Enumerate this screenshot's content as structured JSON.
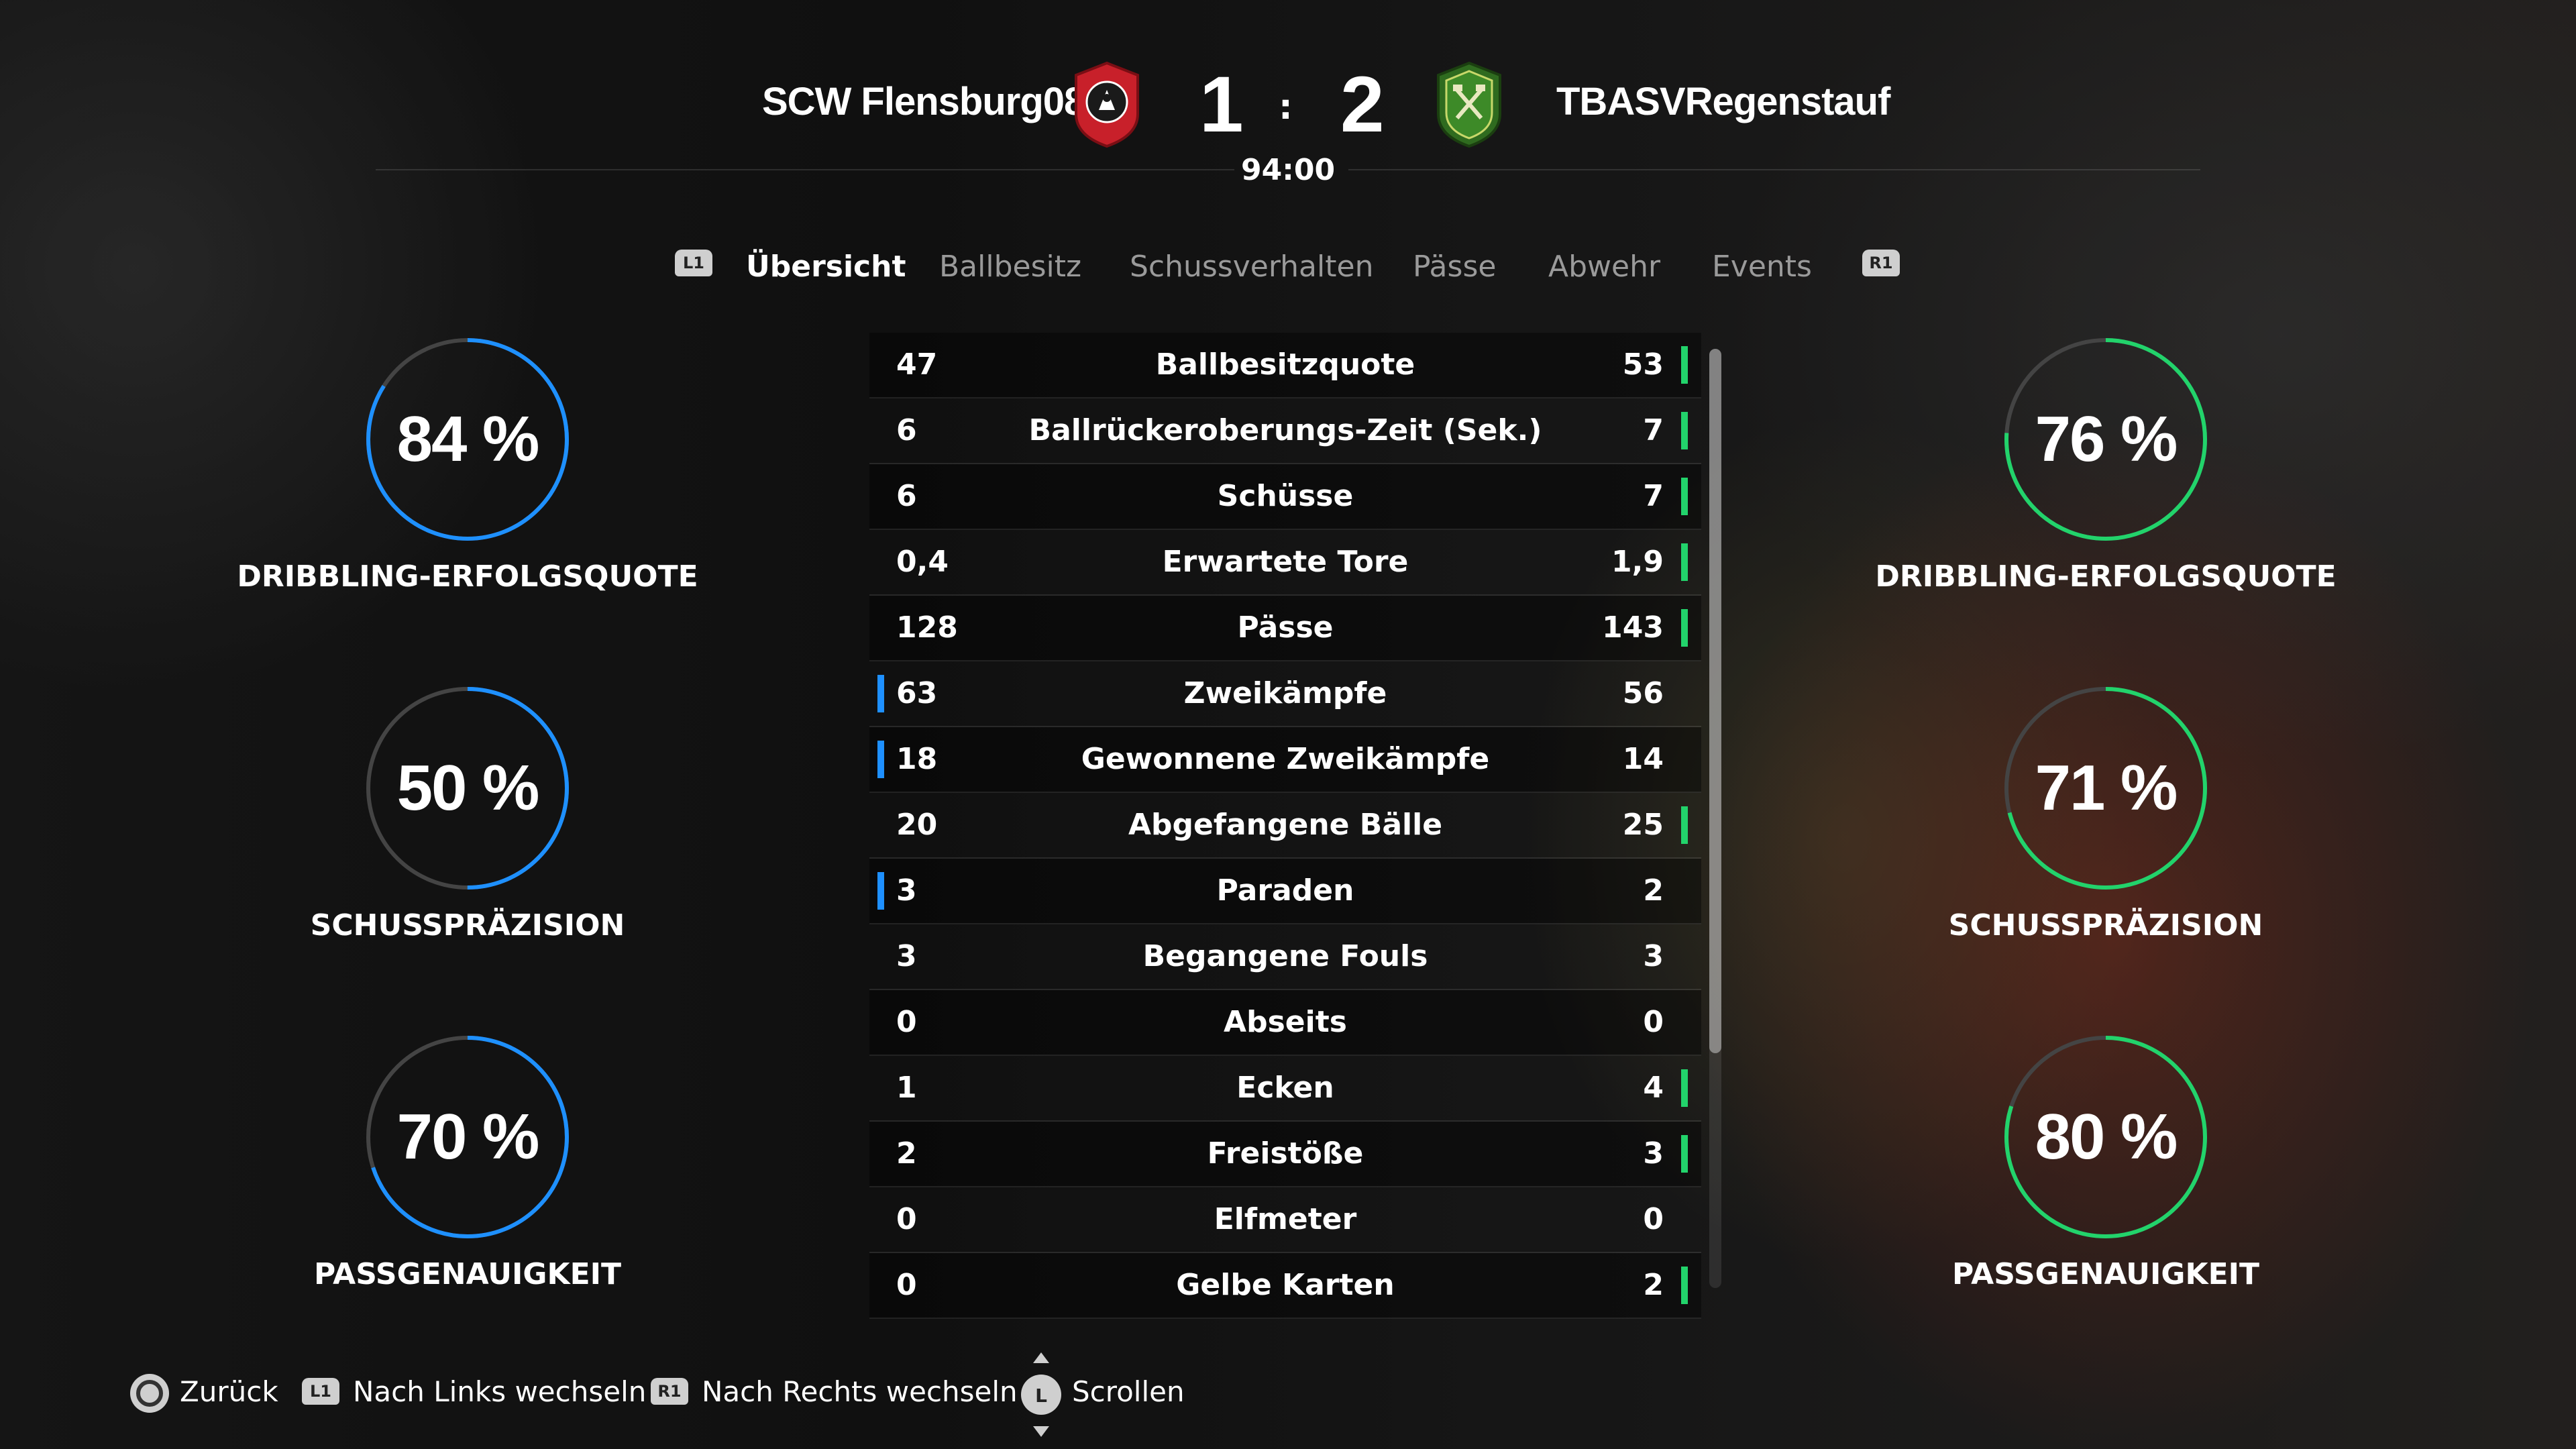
{
  "header": {
    "home_team": "SCW Flensburg08",
    "away_team": "TBASVRegenstauf",
    "home_score": "1",
    "away_score": "2",
    "separator": ":",
    "clock": "94:00",
    "home_color": "#c8202a",
    "away_color": "#2f6b1f"
  },
  "tabs": {
    "left_button": "L1",
    "right_button": "R1",
    "items": [
      "Übersicht",
      "Ballbesitz",
      "Schussverhalten",
      "Pässe",
      "Abwehr",
      "Events"
    ],
    "active_index": 0
  },
  "gauges": {
    "home": [
      {
        "value": "84 %",
        "percent": 84,
        "label": "DRIBBLING-ERFOLGSQUOTE"
      },
      {
        "value": "50 %",
        "percent": 50,
        "label": "SCHUSSPRÄZISION"
      },
      {
        "value": "70 %",
        "percent": 70,
        "label": "PASSGENAUIGKEIT"
      }
    ],
    "away": [
      {
        "value": "76 %",
        "percent": 76,
        "label": "DRIBBLING-ERFOLGSQUOTE"
      },
      {
        "value": "71 %",
        "percent": 71,
        "label": "SCHUSSPRÄZISION"
      },
      {
        "value": "80 %",
        "percent": 80,
        "label": "PASSGENAUIGKEIT"
      }
    ],
    "home_color": "#1e90ff",
    "away_color": "#22d36b"
  },
  "stats": [
    {
      "home": "47",
      "label": "Ballbesitzquote",
      "away": "53",
      "leader": "away"
    },
    {
      "home": "6",
      "label": "Ballrückeroberungs-Zeit (Sek.)",
      "away": "7",
      "leader": "away"
    },
    {
      "home": "6",
      "label": "Schüsse",
      "away": "7",
      "leader": "away"
    },
    {
      "home": "0,4",
      "label": "Erwartete Tore",
      "away": "1,9",
      "leader": "away"
    },
    {
      "home": "128",
      "label": "Pässe",
      "away": "143",
      "leader": "away"
    },
    {
      "home": "63",
      "label": "Zweikämpfe",
      "away": "56",
      "leader": "home"
    },
    {
      "home": "18",
      "label": "Gewonnene Zweikämpfe",
      "away": "14",
      "leader": "home"
    },
    {
      "home": "20",
      "label": "Abgefangene Bälle",
      "away": "25",
      "leader": "away"
    },
    {
      "home": "3",
      "label": "Paraden",
      "away": "2",
      "leader": "home"
    },
    {
      "home": "3",
      "label": "Begangene Fouls",
      "away": "3",
      "leader": "none"
    },
    {
      "home": "0",
      "label": "Abseits",
      "away": "0",
      "leader": "none"
    },
    {
      "home": "1",
      "label": "Ecken",
      "away": "4",
      "leader": "away"
    },
    {
      "home": "2",
      "label": "Freistöße",
      "away": "3",
      "leader": "away"
    },
    {
      "home": "0",
      "label": "Elfmeter",
      "away": "0",
      "leader": "none"
    },
    {
      "home": "0",
      "label": "Gelbe Karten",
      "away": "2",
      "leader": "away"
    }
  ],
  "footer": {
    "back": "Zurück",
    "left_switch_button": "L1",
    "left_switch": "Nach Links wechseln",
    "right_switch_button": "R1",
    "right_switch": "Nach Rechts wechseln",
    "scroll_button": "L",
    "scroll": "Scrollen"
  }
}
